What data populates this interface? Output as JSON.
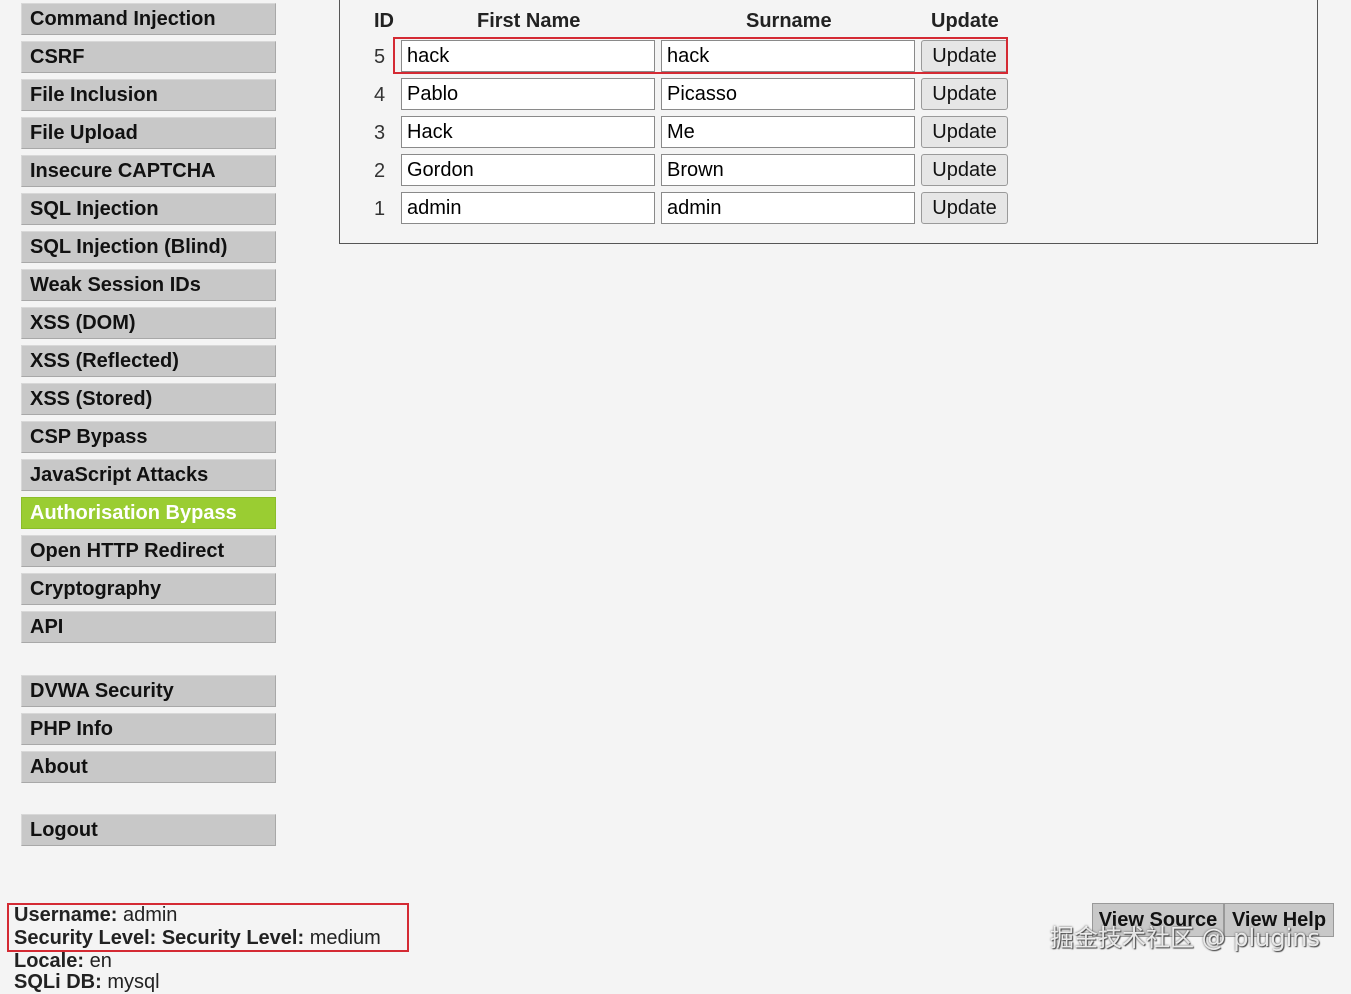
{
  "sidebar": {
    "vuln_items": [
      {
        "label": "Command Injection"
      },
      {
        "label": "CSRF"
      },
      {
        "label": "File Inclusion"
      },
      {
        "label": "File Upload"
      },
      {
        "label": "Insecure CAPTCHA"
      },
      {
        "label": "SQL Injection"
      },
      {
        "label": "SQL Injection (Blind)"
      },
      {
        "label": "Weak Session IDs"
      },
      {
        "label": "XSS (DOM)"
      },
      {
        "label": "XSS (Reflected)"
      },
      {
        "label": "XSS (Stored)"
      },
      {
        "label": "CSP Bypass"
      },
      {
        "label": "JavaScript Attacks"
      },
      {
        "label": "Authorisation Bypass"
      },
      {
        "label": "Open HTTP Redirect"
      },
      {
        "label": "Cryptography"
      },
      {
        "label": "API"
      }
    ],
    "active_item": "Authorisation Bypass",
    "active_color": "#9acd32",
    "config_items": [
      {
        "label": "DVWA Security"
      },
      {
        "label": "PHP Info"
      },
      {
        "label": "About"
      }
    ],
    "logout_label": "Logout"
  },
  "table": {
    "headers": {
      "id": "ID",
      "first_name": "First Name",
      "surname": "Surname",
      "update": "Update"
    },
    "rows": [
      {
        "id": "5",
        "first_name": "hack",
        "surname": "hack",
        "button": "Update"
      },
      {
        "id": "4",
        "first_name": "Pablo",
        "surname": "Picasso",
        "button": "Update"
      },
      {
        "id": "3",
        "first_name": "Hack",
        "surname": "Me",
        "button": "Update"
      },
      {
        "id": "2",
        "first_name": "Gordon",
        "surname": "Brown",
        "button": "Update"
      },
      {
        "id": "1",
        "first_name": "admin",
        "surname": "admin",
        "button": "Update"
      }
    ]
  },
  "highlight_color": "#d42a33",
  "footer": {
    "username_label": "Username:",
    "username_value": "admin",
    "security_label": "Security Level: Security Level:",
    "security_value": "medium",
    "locale_label": "Locale:",
    "locale_value": "en",
    "sqli_label": "SQLi DB:",
    "sqli_value": "mysql",
    "view_source": "View Source",
    "view_help": "View Help"
  },
  "watermark": "掘金技术社区 @ plugins"
}
